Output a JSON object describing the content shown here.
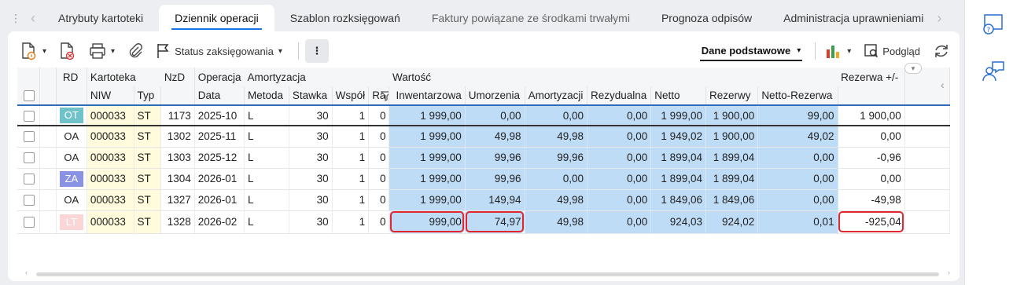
{
  "tabs": {
    "items": [
      {
        "label": "Atrybuty kartoteki",
        "active": false
      },
      {
        "label": "Dziennik operacji",
        "active": true
      },
      {
        "label": "Szablon rozksięgowań",
        "active": false
      },
      {
        "label": "Faktury powiązane ze środkami trwałymi",
        "active": false
      },
      {
        "label": "Prognoza odpisów",
        "active": false
      },
      {
        "label": "Administracja uprawnieniami",
        "active": false
      }
    ]
  },
  "toolbar": {
    "status_label": "Status zaksięgowania",
    "view_label": "Dane podstawowe",
    "preview_label": "Podgląd"
  },
  "columns": {
    "group": {
      "rd": "RD",
      "kartoteka": "Kartoteka",
      "nzd": "NzD",
      "operacja": "Operacja",
      "amortyzacja": "Amortyzacja",
      "wartosc": "Wartość",
      "rezerwa": "Rezerwa +/-"
    },
    "sub": {
      "niw": "NIW",
      "typ": "Typ",
      "data": "Data",
      "metoda": "Metoda",
      "stawka": "Stawka",
      "wspol": "Współ",
      "ra": "Ra",
      "inwentarzowa": "Inwentarzowa",
      "umorzenia": "Umorzenia",
      "amortyzacji": "Amortyzacji",
      "rezydualna": "Rezydualna",
      "netto": "Netto",
      "rezerwy": "Rezerwy",
      "netto_rezerwa": "Netto-Rezerwa"
    }
  },
  "rows": [
    {
      "rd": "OT",
      "rd_bg": "#6fc2c9",
      "rd_fg": "#ffffff",
      "niw": "000033",
      "typ": "ST",
      "nzd": "1173",
      "data": "2025-10",
      "metoda": "L",
      "stawka": "30",
      "wspol": "1",
      "ra": "0",
      "inwentarzowa": "1 999,00",
      "umorzenia": "0,00",
      "amortyzacji": "0,00",
      "rezydualna": "0,00",
      "netto": "1 999,00",
      "rezerwy": "1 900,00",
      "netto_rezerwa": "99,00",
      "rezerwa_pm": "1 900,00"
    },
    {
      "rd": "OA",
      "rd_bg": "",
      "rd_fg": "#222222",
      "niw": "000033",
      "typ": "ST",
      "nzd": "1302",
      "data": "2025-11",
      "metoda": "L",
      "stawka": "30",
      "wspol": "1",
      "ra": "0",
      "inwentarzowa": "1 999,00",
      "umorzenia": "49,98",
      "amortyzacji": "49,98",
      "rezydualna": "0,00",
      "netto": "1 949,02",
      "rezerwy": "1 900,00",
      "netto_rezerwa": "49,02",
      "rezerwa_pm": "0,00"
    },
    {
      "rd": "OA",
      "rd_bg": "",
      "rd_fg": "#222222",
      "niw": "000033",
      "typ": "ST",
      "nzd": "1303",
      "data": "2025-12",
      "metoda": "L",
      "stawka": "30",
      "wspol": "1",
      "ra": "0",
      "inwentarzowa": "1 999,00",
      "umorzenia": "99,96",
      "amortyzacji": "99,96",
      "rezydualna": "0,00",
      "netto": "1 899,04",
      "rezerwy": "1 899,04",
      "netto_rezerwa": "0,00",
      "rezerwa_pm": "-0,96"
    },
    {
      "rd": "ZA",
      "rd_bg": "#8a93e3",
      "rd_fg": "#ffffff",
      "niw": "000033",
      "typ": "ST",
      "nzd": "1304",
      "data": "2026-01",
      "metoda": "L",
      "stawka": "30",
      "wspol": "1",
      "ra": "0",
      "inwentarzowa": "1 999,00",
      "umorzenia": "99,96",
      "amortyzacji": "0,00",
      "rezydualna": "0,00",
      "netto": "1 899,04",
      "rezerwy": "1 899,04",
      "netto_rezerwa": "0,00",
      "rezerwa_pm": "0,00"
    },
    {
      "rd": "OA",
      "rd_bg": "",
      "rd_fg": "#222222",
      "niw": "000033",
      "typ": "ST",
      "nzd": "1327",
      "data": "2026-01",
      "metoda": "L",
      "stawka": "30",
      "wspol": "1",
      "ra": "0",
      "inwentarzowa": "1 999,00",
      "umorzenia": "149,94",
      "amortyzacji": "49,98",
      "rezydualna": "0,00",
      "netto": "1 849,06",
      "rezerwy": "1 849,06",
      "netto_rezerwa": "0,00",
      "rezerwa_pm": "-49,98"
    },
    {
      "rd": "LT",
      "rd_bg": "#fbd6d6",
      "rd_fg": "#ffffff",
      "niw": "000033",
      "typ": "ST",
      "nzd": "1328",
      "data": "2026-02",
      "metoda": "L",
      "stawka": "30",
      "wspol": "1",
      "ra": "0",
      "inwentarzowa": "999,00",
      "umorzenia": "74,97",
      "amortyzacji": "49,98",
      "rezydualna": "0,00",
      "netto": "924,03",
      "rezerwy": "924,02",
      "netto_rezerwa": "0,01",
      "rezerwa_pm": "-925,04"
    }
  ],
  "colors": {
    "accent": "#1a73e8",
    "value_cell": "#bedcf6",
    "kartoteka_cell": "#fffbdc",
    "highlight": "#e0262e"
  }
}
